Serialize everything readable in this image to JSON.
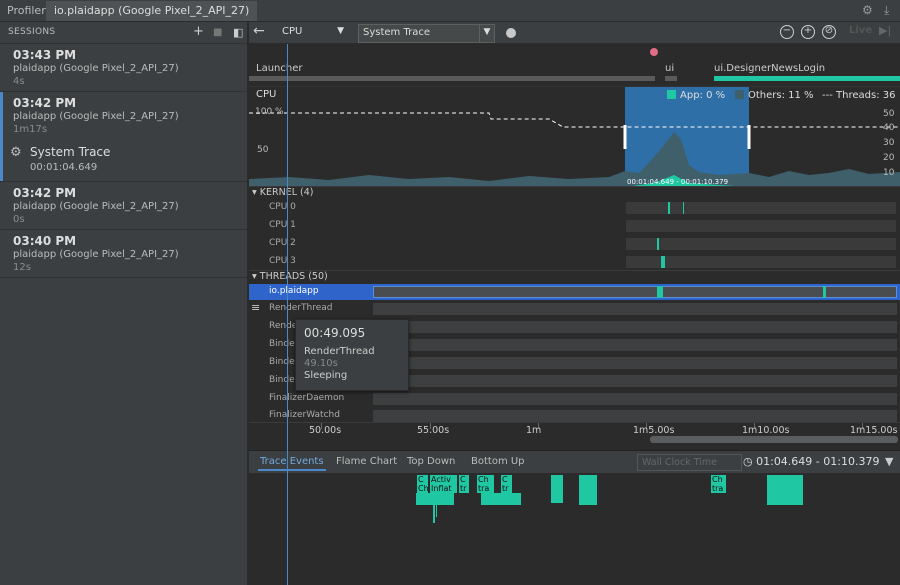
{
  "titlebar": {
    "app_label": "Profiler",
    "tab_label": "io.plaidapp (Google Pixel_2_API_27)"
  },
  "sessions": {
    "header": "SESSIONS",
    "items": [
      {
        "time": "03:43 PM",
        "device": "plaidapp (Google Pixel_2_API_27)",
        "duration": "4s"
      },
      {
        "time": "03:42 PM",
        "device": "plaidapp (Google Pixel_2_API_27)",
        "duration": "1m17s"
      },
      {
        "time": "03:42 PM",
        "device": "plaidapp (Google Pixel_2_API_27)",
        "duration": "0s"
      },
      {
        "time": "03:40 PM",
        "device": "plaidapp (Google Pixel_2_API_27)",
        "duration": "12s"
      }
    ],
    "trace": {
      "name": "System Trace",
      "time": "00:01:04.649"
    }
  },
  "toolbar": {
    "profiler": "CPU",
    "config": "System Trace",
    "live_label": "Live"
  },
  "activities": [
    {
      "label": "Launcher"
    },
    {
      "label": "ui"
    },
    {
      "label": "ui.DesignerNewsLogin"
    }
  ],
  "cpu": {
    "label": "CPU",
    "legend": {
      "app": "App: 0 %",
      "others": "Others: 11 %",
      "threads": "Threads: 36"
    },
    "y_left": [
      "100 %",
      "50"
    ],
    "y_right": [
      "50",
      "40",
      "30",
      "20",
      "10"
    ],
    "selection_label": "00:01:04.649 - 00:01:10.379",
    "colors": {
      "app": "#1fc7a3",
      "others": "#3f5f6b",
      "selection": "#2f6fa8"
    }
  },
  "kernel": {
    "header": "KERNEL (4)",
    "cores": [
      "CPU 0",
      "CPU 1",
      "CPU 2",
      "CPU 3"
    ]
  },
  "threads": {
    "header": "THREADS (50)",
    "selected": "io.plaidapp",
    "rows": [
      "RenderThread",
      "Render",
      "Binder",
      "Binder",
      "Binder",
      "FinalizerDaemon",
      "FinalizerWatchd"
    ]
  },
  "tooltip": {
    "time": "00:49.095",
    "thread": "RenderThread",
    "duration": "49.10s",
    "state": "Sleeping"
  },
  "axis": {
    "ticks": [
      "50.00s",
      "55.00s",
      "1m",
      "1m5.00s",
      "1m10.00s",
      "1m15.00s"
    ]
  },
  "bottom": {
    "tabs": [
      "Trace Events",
      "Flame Chart",
      "Top Down",
      "Bottom Up"
    ],
    "clock": "Wall Clock Time",
    "range": "01:04.649 - 01:10.379",
    "flame_labels": [
      "C",
      "Activ",
      "C",
      "Ch",
      "C",
      "Ch",
      "C",
      "C",
      "Ch",
      "Inflat",
      "tr",
      "tra",
      "tr",
      "tr",
      "tra"
    ]
  }
}
